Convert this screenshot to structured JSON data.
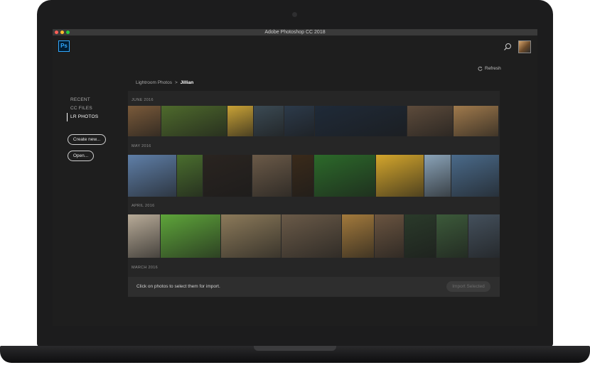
{
  "window": {
    "title": "Adobe Photoshop CC 2018"
  },
  "appbar": {
    "logo": "Ps",
    "search_icon": "search-icon",
    "avatar_icon": "user-avatar"
  },
  "refresh": {
    "label": "Refresh",
    "icon": "refresh-icon"
  },
  "sidebar": {
    "items": [
      {
        "label": "RECENT",
        "active": false
      },
      {
        "label": "CC FILES",
        "active": false
      },
      {
        "label": "LR PHOTOS",
        "active": true
      }
    ],
    "create_label": "Create new...",
    "open_label": "Open..."
  },
  "breadcrumb": {
    "parent": "Lightroom Photos",
    "separator": ">",
    "current": "Jillian"
  },
  "sections": [
    {
      "label": "JUNE 2016",
      "photos": [
        "#7a5a3a",
        "#4e6a2c",
        "#c9a236",
        "#3b4a54",
        "#2c3a4a",
        "#1f2a38",
        "#5d4b3b",
        "#a07a4c"
      ]
    },
    {
      "label": "MAY 2016",
      "photos": [
        "#5f7fa8",
        "#4a6e2e",
        "#2a2420",
        "#6b5a48",
        "#3a2a1a",
        "#2c6a2a",
        "#d4a62c",
        "#8aa3b8",
        "#4a6a8a"
      ]
    },
    {
      "label": "APRIL 2016",
      "photos": [
        "#b8ab98",
        "#5ea53a",
        "#8c7a5a",
        "#6a5a48",
        "#a37a3c",
        "#6a5440",
        "#2a3a2a",
        "#3c5a3a",
        "#44505c"
      ]
    },
    {
      "label": "MARCH 2016",
      "photos": []
    }
  ],
  "footer": {
    "hint": "Click on photos to select them for import.",
    "import_label": "Import Selected"
  }
}
